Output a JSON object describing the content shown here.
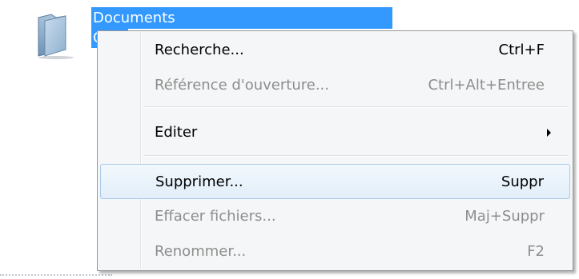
{
  "folder": {
    "name": "Documents",
    "sub_text": "C",
    "icon": "folder-icon"
  },
  "menu": {
    "items": [
      {
        "label": "Recherche...",
        "shortcut": "Ctrl+F",
        "enabled": true
      },
      {
        "label": "Référence d'ouverture...",
        "shortcut": "Ctrl+Alt+Entree",
        "enabled": false
      },
      {
        "label": "Editer",
        "shortcut": "",
        "enabled": true,
        "submenu": true,
        "icon": "submenu-arrow-icon"
      },
      {
        "label": "Supprimer...",
        "shortcut": "Suppr",
        "enabled": true,
        "highlighted": true
      },
      {
        "label": "Effacer fichiers...",
        "shortcut": "Maj+Suppr",
        "enabled": false
      },
      {
        "label": "Renommer...",
        "shortcut": "F2",
        "enabled": false
      }
    ]
  },
  "colors": {
    "selection": "#3399ff",
    "menu_background": "#f5f6f7",
    "highlight_border": "#a8cae8",
    "disabled_text": "#8d8d8d"
  }
}
